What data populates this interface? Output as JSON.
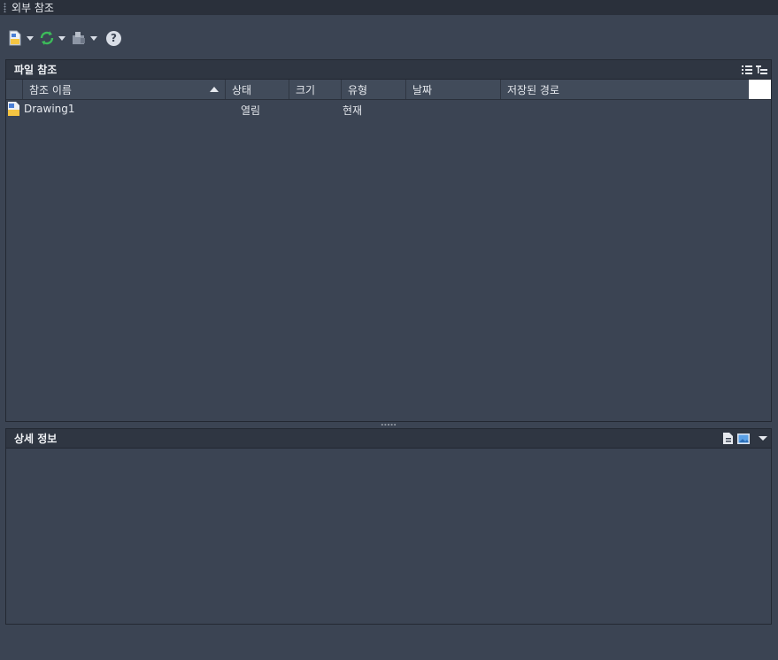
{
  "window": {
    "title": "외부 참조"
  },
  "toolbar": {
    "attach_icon": "attach-dwg-icon",
    "refresh_icon": "refresh-icon",
    "change_path_icon": "change-path-icon",
    "help_label": "?"
  },
  "file_refs": {
    "title": "파일 참조",
    "columns": [
      "참조 이름",
      "상태",
      "크기",
      "유형",
      "날짜",
      "저장된 경로"
    ],
    "rows": [
      {
        "name": "Drawing1",
        "status": "열림",
        "size": "",
        "type": "현재",
        "date": "",
        "path": ""
      }
    ]
  },
  "details": {
    "title": "상세 정보"
  },
  "colors": {
    "background": "#3b4453",
    "header": "#2f3642",
    "accent_green": "#3dbb5a",
    "file_yellow": "#f5c542"
  }
}
